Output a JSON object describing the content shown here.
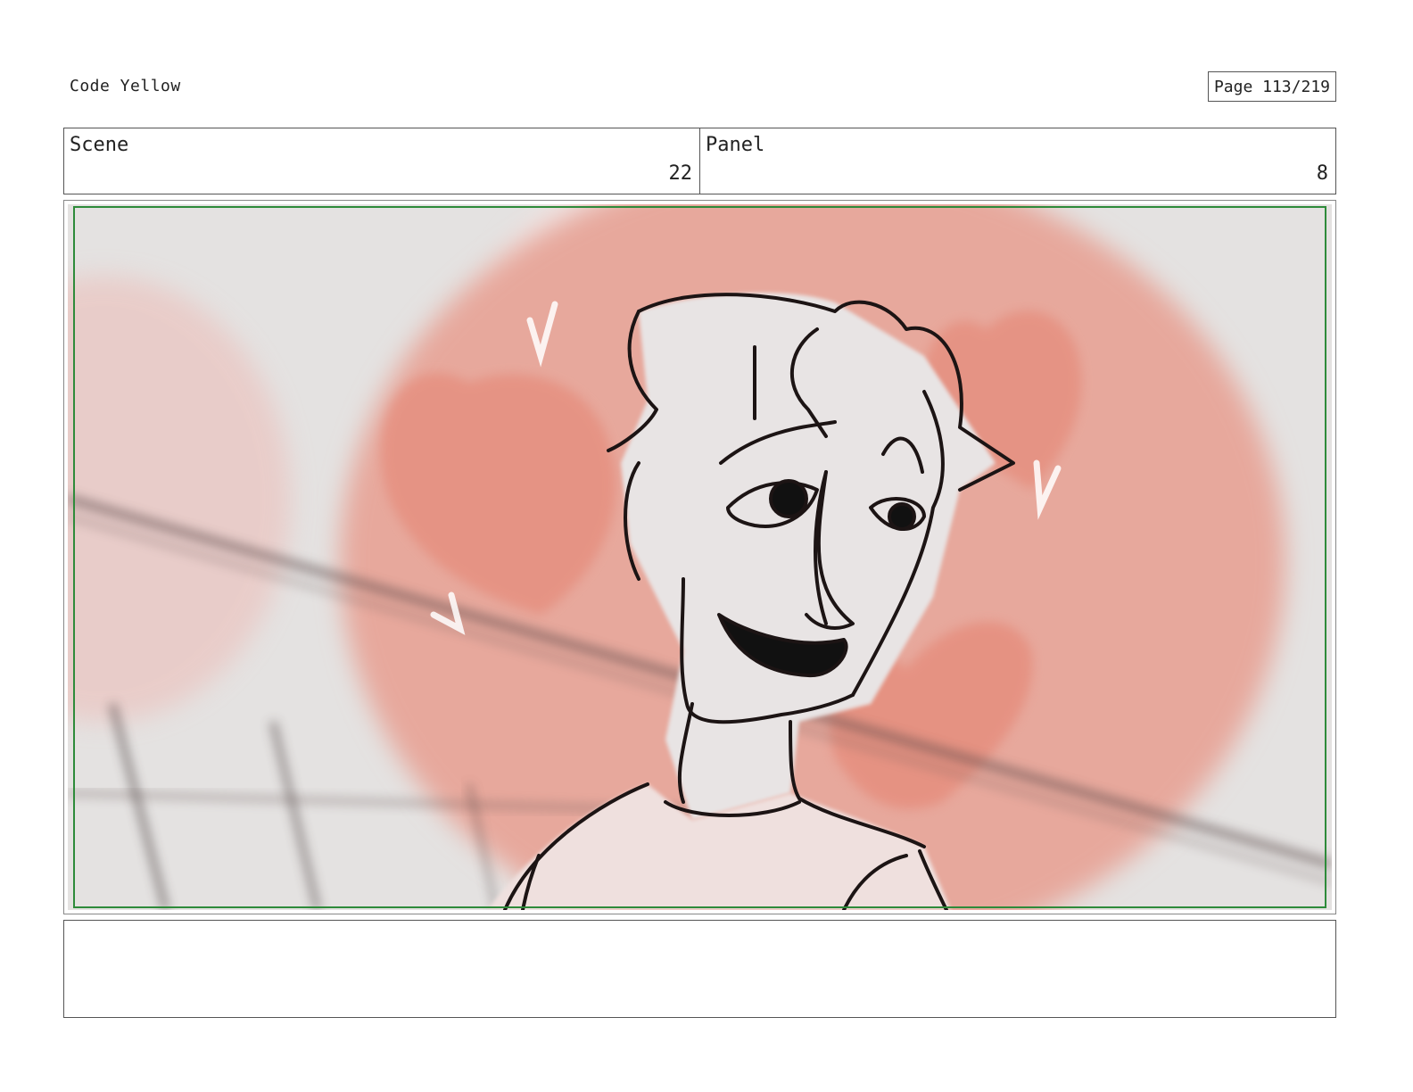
{
  "document": {
    "title": "Code Yellow",
    "page_label": "Page 113/219"
  },
  "scene": {
    "label": "Scene",
    "value": "22"
  },
  "panel": {
    "label": "Panel",
    "value": "8"
  },
  "frame": {
    "image_alt": "Storyboard drawing"
  },
  "notes": {
    "text": ""
  },
  "colors": {
    "guide": "#2e8b3a",
    "accent": "#e8836f"
  }
}
